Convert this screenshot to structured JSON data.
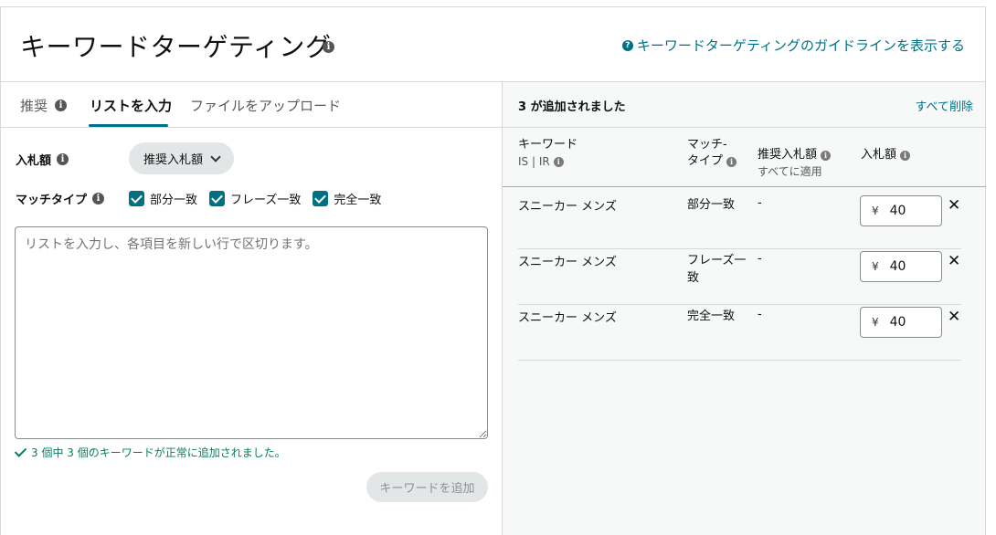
{
  "header": {
    "title": "キーワードターゲティング",
    "guide_link": "キーワードターゲティングのガイドラインを表示する"
  },
  "tabs": [
    {
      "label": "推奨"
    },
    {
      "label": "リストを入力"
    },
    {
      "label": "ファイルをアップロード"
    }
  ],
  "form": {
    "bid_label": "入札額",
    "bid_dropdown": "推奨入札額",
    "match_type_label": "マッチタイプ",
    "match_options": [
      {
        "label": "部分一致"
      },
      {
        "label": "フレーズ一致"
      },
      {
        "label": "完全一致"
      }
    ],
    "textarea_placeholder": "リストを入力し、各項目を新しい行で区切ります。",
    "success_message": "3 個中 3 個のキーワードが正常に追加されました。",
    "add_button": "キーワードを追加"
  },
  "added": {
    "count_text": "3 が追加されました",
    "clear_all": "すべて削除",
    "columns": {
      "keyword": "キーワード",
      "keyword_sub": "IS | IR",
      "match_type_line1": "マッチ-",
      "match_type_line2": "タイプ",
      "suggested_bid": "推奨入札額",
      "suggested_sub": "すべてに適用",
      "bid": "入札額"
    },
    "rows": [
      {
        "keyword": "スニーカー メンズ",
        "match_type": "部分一致",
        "suggested": "-",
        "currency": "¥",
        "bid": "40"
      },
      {
        "keyword": "スニーカー メンズ",
        "match_type": "フレーズ一致",
        "suggested": "-",
        "currency": "¥",
        "bid": "40"
      },
      {
        "keyword": "スニーカー メンズ",
        "match_type": "完全一致",
        "suggested": "-",
        "currency": "¥",
        "bid": "40"
      }
    ]
  },
  "colors": {
    "accent": "#007185",
    "success": "#067d62",
    "border": "#d5d9d9"
  }
}
